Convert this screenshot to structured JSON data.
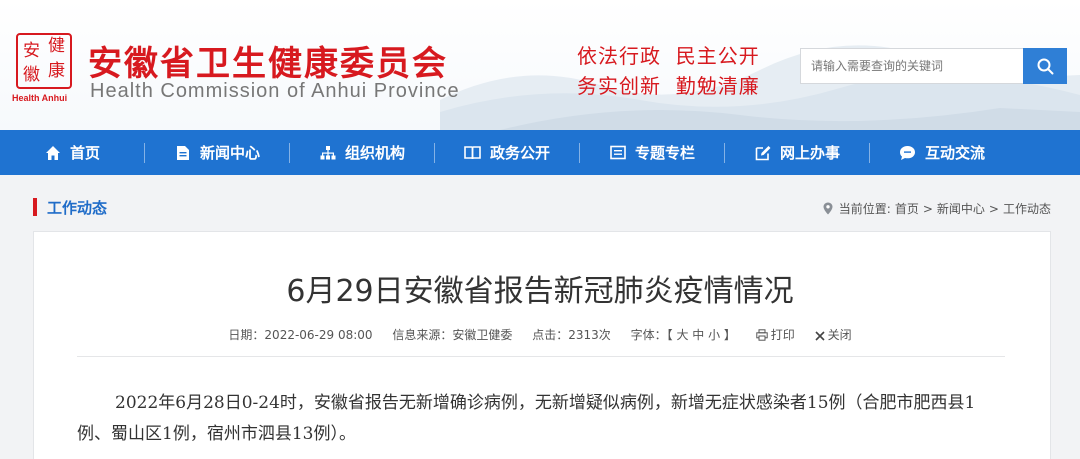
{
  "header": {
    "seal_chars": [
      "健",
      "安",
      "康",
      "徽"
    ],
    "seal_en": "Health Anhui",
    "title": "安徽省卫生健康委员会",
    "subtitle": "Health Commission of Anhui Province",
    "slogan_line1": "依法行政  民主公开",
    "slogan_line2": "务实创新  勤勉清廉",
    "search_placeholder": "请输入需要查询的关键词",
    "brand_red": "#d7191f",
    "brand_blue": "#1f73d1"
  },
  "nav": {
    "items": [
      {
        "label": "首页",
        "icon": "home-icon"
      },
      {
        "label": "新闻中心",
        "icon": "document-icon"
      },
      {
        "label": "组织机构",
        "icon": "org-chart-icon"
      },
      {
        "label": "政务公开",
        "icon": "book-icon"
      },
      {
        "label": "专题专栏",
        "icon": "folder-icon"
      },
      {
        "label": "网上办事",
        "icon": "edit-icon"
      },
      {
        "label": "互动交流",
        "icon": "chat-icon"
      }
    ]
  },
  "location": {
    "section": "工作动态",
    "prefix": "当前位置:",
    "crumbs": [
      "首页",
      "新闻中心",
      "工作动态"
    ],
    "separator": ">"
  },
  "article": {
    "title": "6月29日安徽省报告新冠肺炎疫情情况",
    "date": "日期：2022-06-29 08:00",
    "source": "信息来源：安徽卫健委",
    "clicks": "点击：2313次",
    "font_label": "字体：",
    "font_sizes": "【 大 中 小 】",
    "print_label": "打印",
    "close_label": "关闭",
    "body": "2022年6月28日0-24时，安徽省报告无新增确诊病例，无新增疑似病例，新增无症状感染者15例（合肥市肥西县1例、蜀山区1例，宿州市泗县13例）。"
  }
}
